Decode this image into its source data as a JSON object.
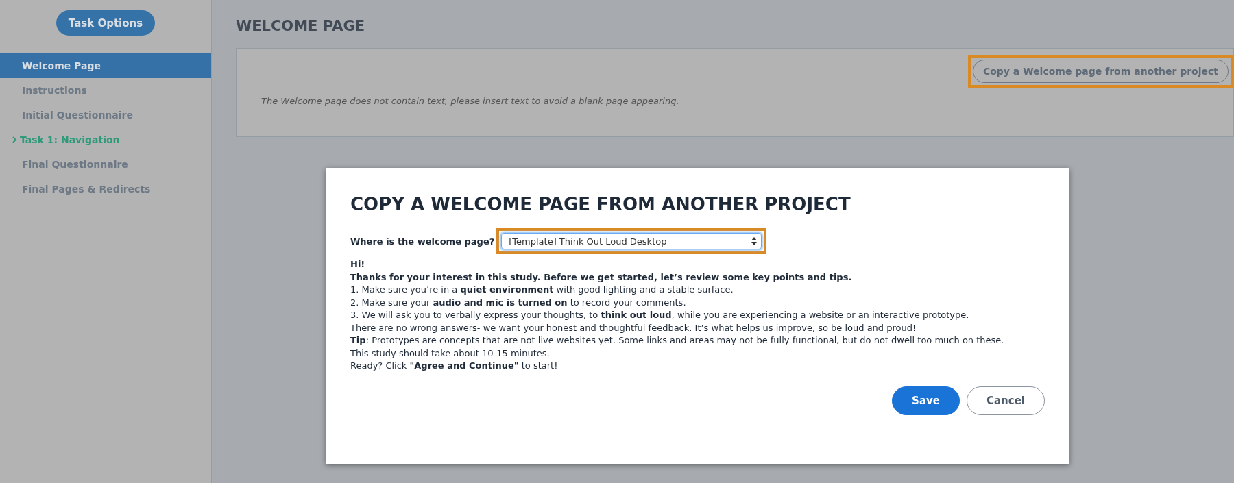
{
  "sidebar": {
    "button": "Task Options",
    "items": [
      {
        "label": "Welcome Page",
        "selected": true,
        "current": false
      },
      {
        "label": "Instructions",
        "selected": false,
        "current": false
      },
      {
        "label": "Initial Questionnaire",
        "selected": false,
        "current": false
      },
      {
        "label": "Task 1: Navigation",
        "selected": false,
        "current": true
      },
      {
        "label": "Final Questionnaire",
        "selected": false,
        "current": false
      },
      {
        "label": "Final Pages & Redirects",
        "selected": false,
        "current": false
      }
    ]
  },
  "page": {
    "title": "WELCOME PAGE",
    "copy_button": "Copy a Welcome page from another project",
    "copy_button_highlighted": true,
    "notice": "The Welcome page does not contain text, please insert text to avoid a blank page appearing."
  },
  "dialog": {
    "title": "COPY A WELCOME PAGE FROM ANOTHER PROJECT",
    "field_label": "Where is the welcome page?",
    "select_value": "[Template] Think Out Loud Desktop",
    "select_highlighted": true,
    "lines": [
      "**Hi!**",
      "**Thanks for your interest in this study. Before we get started, let’s review some key points and tips.**",
      "1. Make sure you’re in a **quiet environment** with good lighting and a stable surface.",
      "2. Make sure your **audio and mic is turned on** to record your comments.",
      "3. We will ask you to verbally express your thoughts, to **think out loud**, while you are experiencing a website or an interactive prototype.",
      "There are no wrong answers- we want your honest and thoughtful feedback. It’s what helps us improve, so be loud and proud!",
      "**Tip**: Prototypes are concepts that are not live websites yet. Some links and areas may not be fully functional, but do not dwell too much on these.",
      "This study should take about 10-15 minutes.",
      "Ready? Click **\"Agree and Continue\"** to start!"
    ],
    "buttons": [
      {
        "label": "Save",
        "kind": "primary"
      },
      {
        "label": "Cancel",
        "kind": "secondary"
      }
    ]
  }
}
